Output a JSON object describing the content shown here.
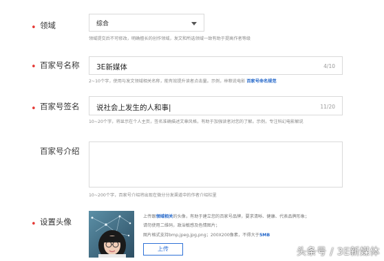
{
  "fields": {
    "domain": {
      "label": "领域",
      "value": "综合",
      "hint": "领域提交后不可修改，明确擅长的创作领域，发文和所选领域一致有助于提高作者等级"
    },
    "name": {
      "label": "百家号名称",
      "value": "3E新媒体",
      "count": "4/10",
      "hint": "2~10个字，使用与发文领域相关名称，能有效提升读者点击量。示例，林粮说电影",
      "hint_link": "百家号命名规范"
    },
    "signature": {
      "label": "百家号签名",
      "value": "说社会上发生的人和事|",
      "count": "11/20",
      "hint": "10~20个字，将显示在个人主页，签名准确描述文章风格，有助于加强读者对您的了解。示例，专注科幻电影解说"
    },
    "intro": {
      "label": "百家号介绍",
      "value": "",
      "hint": "10~200个字，百家号介绍将出现在微分分发渠道中的作者介绍栏里"
    },
    "avatar": {
      "label": "设置头像",
      "line1_pre": "上传跟",
      "line1_hl": "领域相关",
      "line1_post": "的头像，有助于建立您的百家号品牌，要求清晰、健康、代表品牌形象；",
      "line2": "请勿使用二维码，政治敏感及色情图片；",
      "line3_pre": "图片格式支持bmp,jpeg,jpg,png；200X200像素，不得大于",
      "line3_hl": "5MB",
      "upload_label": "上传"
    }
  },
  "watermark": "头条号 / 3E新媒体",
  "colors": {
    "required": "#e53935",
    "link": "#1e63c8",
    "border": "#d9d9d9"
  }
}
